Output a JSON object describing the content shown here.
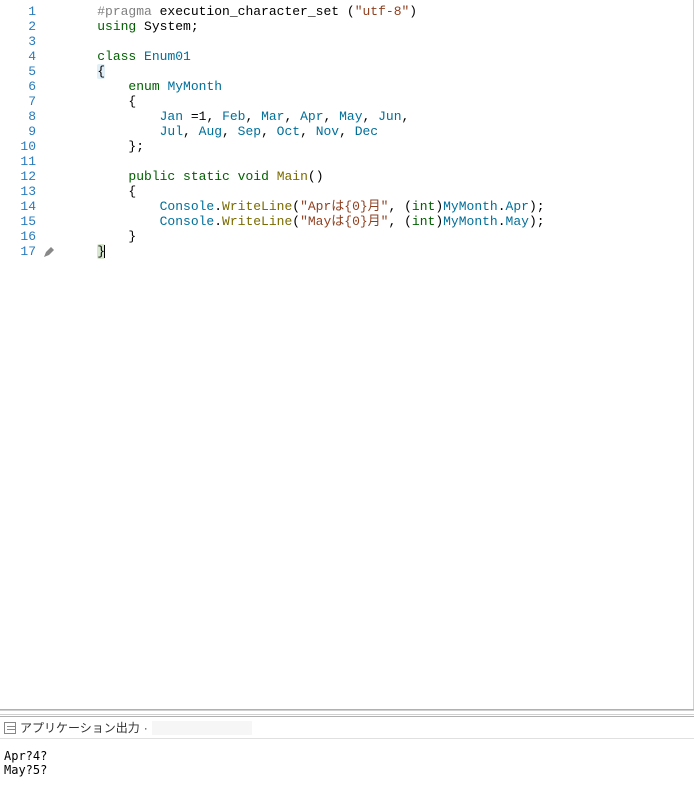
{
  "lines": [
    {
      "n": 1,
      "indent": 1,
      "tokens": [
        [
          "#pragma",
          "c-gray"
        ],
        [
          " execution_character_set ",
          "c-punct"
        ],
        [
          "(",
          "c-punct"
        ],
        [
          "\"utf-8\"",
          "c-str"
        ],
        [
          ")",
          "c-punct"
        ]
      ]
    },
    {
      "n": 2,
      "indent": 1,
      "tokens": [
        [
          "using",
          "c-key"
        ],
        [
          " System;",
          "c-punct"
        ]
      ]
    },
    {
      "n": 3,
      "indent": 1,
      "tokens": []
    },
    {
      "n": 4,
      "indent": 1,
      "tokens": [
        [
          "class",
          "c-key"
        ],
        [
          " ",
          "c-punct"
        ],
        [
          "Enum01",
          "c-type"
        ]
      ]
    },
    {
      "n": 5,
      "indent": 1,
      "tokens": [
        [
          "{",
          "c-punct bg-brace1"
        ]
      ]
    },
    {
      "n": 6,
      "indent": 2,
      "tokens": [
        [
          "enum",
          "c-key"
        ],
        [
          " ",
          "c-punct"
        ],
        [
          "MyMonth",
          "c-type"
        ]
      ]
    },
    {
      "n": 7,
      "indent": 2,
      "tokens": [
        [
          "{",
          "c-punct"
        ]
      ]
    },
    {
      "n": 8,
      "indent": 3,
      "tokens": [
        [
          "Jan",
          "c-field"
        ],
        [
          " =",
          "c-punct"
        ],
        [
          "1",
          "c-punct"
        ],
        [
          ", ",
          "c-punct"
        ],
        [
          "Feb",
          "c-field"
        ],
        [
          ", ",
          "c-punct"
        ],
        [
          "Mar",
          "c-field"
        ],
        [
          ", ",
          "c-punct"
        ],
        [
          "Apr",
          "c-field"
        ],
        [
          ", ",
          "c-punct"
        ],
        [
          "May",
          "c-field"
        ],
        [
          ", ",
          "c-punct"
        ],
        [
          "Jun",
          "c-field"
        ],
        [
          ",",
          "c-punct"
        ]
      ]
    },
    {
      "n": 9,
      "indent": 3,
      "tokens": [
        [
          "Jul",
          "c-field"
        ],
        [
          ", ",
          "c-punct"
        ],
        [
          "Aug",
          "c-field"
        ],
        [
          ", ",
          "c-punct"
        ],
        [
          "Sep",
          "c-field"
        ],
        [
          ", ",
          "c-punct"
        ],
        [
          "Oct",
          "c-field"
        ],
        [
          ", ",
          "c-punct"
        ],
        [
          "Nov",
          "c-field"
        ],
        [
          ", ",
          "c-punct"
        ],
        [
          "Dec",
          "c-field"
        ]
      ]
    },
    {
      "n": 10,
      "indent": 2,
      "tokens": [
        [
          "};",
          "c-punct"
        ]
      ]
    },
    {
      "n": 11,
      "indent": 1,
      "tokens": []
    },
    {
      "n": 12,
      "indent": 2,
      "tokens": [
        [
          "public",
          "c-key"
        ],
        [
          " ",
          "c-punct"
        ],
        [
          "static",
          "c-key"
        ],
        [
          " ",
          "c-punct"
        ],
        [
          "void",
          "c-key"
        ],
        [
          " ",
          "c-punct"
        ],
        [
          "Main",
          "c-method"
        ],
        [
          "()",
          "c-punct"
        ]
      ]
    },
    {
      "n": 13,
      "indent": 2,
      "tokens": [
        [
          "{",
          "c-punct"
        ]
      ]
    },
    {
      "n": 14,
      "indent": 3,
      "tokens": [
        [
          "Console",
          "c-type"
        ],
        [
          ".",
          "c-punct"
        ],
        [
          "WriteLine",
          "c-method"
        ],
        [
          "(",
          "c-punct"
        ],
        [
          "\"Aprは{0}月\"",
          "c-str"
        ],
        [
          ", (",
          "c-punct"
        ],
        [
          "int",
          "c-key"
        ],
        [
          ")",
          "c-punct"
        ],
        [
          "MyMonth",
          "c-type"
        ],
        [
          ".",
          "c-punct"
        ],
        [
          "Apr",
          "c-field"
        ],
        [
          ");",
          "c-punct"
        ]
      ]
    },
    {
      "n": 15,
      "indent": 3,
      "tokens": [
        [
          "Console",
          "c-type"
        ],
        [
          ".",
          "c-punct"
        ],
        [
          "WriteLine",
          "c-method"
        ],
        [
          "(",
          "c-punct"
        ],
        [
          "\"Mayは{0}月\"",
          "c-str"
        ],
        [
          ", (",
          "c-punct"
        ],
        [
          "int",
          "c-key"
        ],
        [
          ")",
          "c-punct"
        ],
        [
          "MyMonth",
          "c-type"
        ],
        [
          ".",
          "c-punct"
        ],
        [
          "May",
          "c-field"
        ],
        [
          ");",
          "c-punct"
        ]
      ]
    },
    {
      "n": 16,
      "indent": 2,
      "tokens": [
        [
          "}",
          "c-punct"
        ]
      ]
    },
    {
      "n": 17,
      "indent": 1,
      "pencil": true,
      "tokens": [
        [
          "}",
          "c-punct bg-brace2 cursor-brace"
        ]
      ]
    }
  ],
  "indentUnit": "    ",
  "output": {
    "header_label": "アプリケーション出力",
    "dot": "·",
    "lines": [
      "Apr?4?",
      "May?5?"
    ]
  }
}
